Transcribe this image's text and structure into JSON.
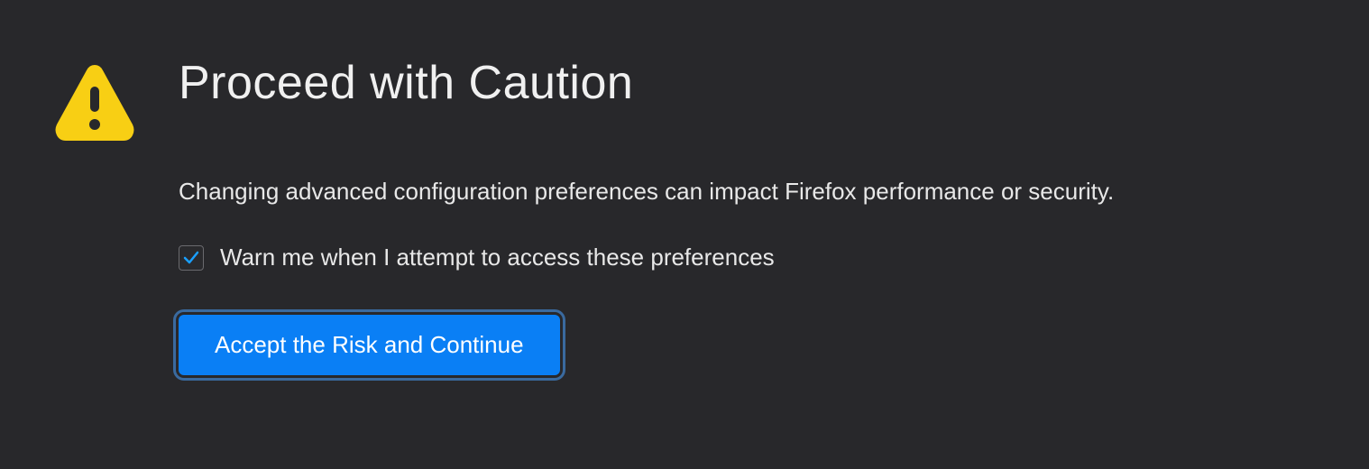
{
  "warning": {
    "title": "Proceed with Caution",
    "description": "Changing advanced configuration preferences can impact Firefox performance or security.",
    "checkbox_label": "Warn me when I attempt to access these preferences",
    "checkbox_checked": true,
    "button_label": "Accept the Risk and Continue"
  },
  "colors": {
    "background": "#28282b",
    "text": "#e8e8e8",
    "warning_icon": "#f8cf14",
    "button_bg": "#0a7ff5",
    "button_outline": "#3a6a9f",
    "checkmark": "#1a9fff"
  }
}
